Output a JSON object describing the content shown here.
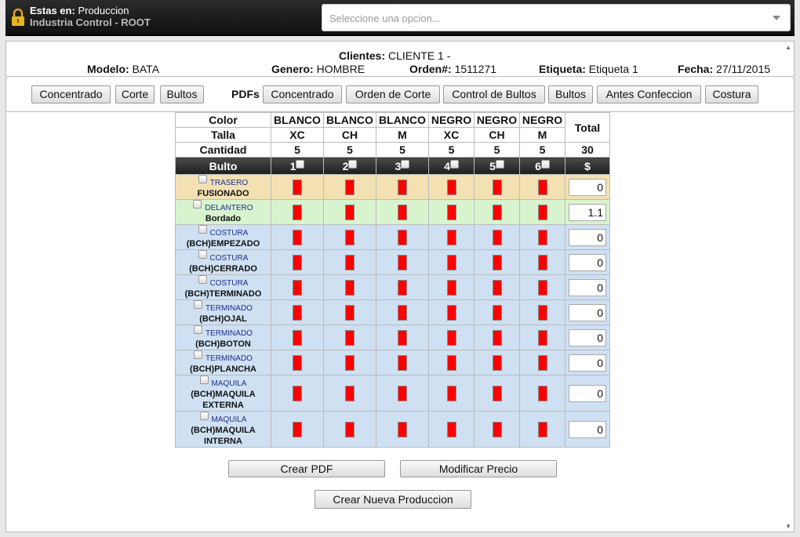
{
  "header": {
    "location_label": "Estas en:",
    "location_value": "Produccion",
    "subtitle": "Industria Control - ROOT",
    "select_placeholder": "Seleccione una opcion..."
  },
  "info": {
    "clientes_label": "Clientes:",
    "clientes_value": "CLIENTE 1 -",
    "modelo_label": "Modelo:",
    "modelo_value": "BATA",
    "genero_label": "Genero:",
    "genero_value": "HOMBRE",
    "orden_label": "Orden#:",
    "orden_value": "1511271",
    "etiqueta_label": "Etiqueta:",
    "etiqueta_value": "Etiqueta 1",
    "fecha_label": "Fecha:",
    "fecha_value": "27/11/2015"
  },
  "toolbar": {
    "concentrado": "Concentrado",
    "corte": "Corte",
    "bultos": "Bultos",
    "pdfs_label": "PDFs",
    "pdf_concentrado": "Concentrado",
    "pdf_orden_corte": "Orden de Corte",
    "pdf_control_bultos": "Control de Bultos",
    "pdf_bultos": "Bultos",
    "pdf_antes_confeccion": "Antes Confeccion",
    "pdf_costura": "Costura"
  },
  "table": {
    "color_label": "Color",
    "talla_label": "Talla",
    "cantidad_label": "Cantidad",
    "bulto_label": "Bulto",
    "total_label": "Total",
    "total_value": "30",
    "currency_label": "$",
    "columns": [
      {
        "color": "BLANCO",
        "talla": "XC",
        "cantidad": "5",
        "bulto": "1"
      },
      {
        "color": "BLANCO",
        "talla": "CH",
        "cantidad": "5",
        "bulto": "2"
      },
      {
        "color": "BLANCO",
        "talla": "M",
        "cantidad": "5",
        "bulto": "3"
      },
      {
        "color": "NEGRO",
        "talla": "XC",
        "cantidad": "5",
        "bulto": "4"
      },
      {
        "color": "NEGRO",
        "talla": "CH",
        "cantidad": "5",
        "bulto": "5"
      },
      {
        "color": "NEGRO",
        "talla": "M",
        "cantidad": "5",
        "bulto": "6"
      }
    ],
    "rows": [
      {
        "stage": "TRASERO",
        "name": "FUSIONADO",
        "price": "0",
        "tone": "tan"
      },
      {
        "stage": "DELANTERO",
        "name": "Bordado",
        "price": "1.1",
        "tone": "green"
      },
      {
        "stage": "COSTURA",
        "name": "(BCH)EMPEZADO",
        "price": "0",
        "tone": "blue"
      },
      {
        "stage": "COSTURA",
        "name": "(BCH)CERRADO",
        "price": "0",
        "tone": "blue"
      },
      {
        "stage": "COSTURA",
        "name": "(BCH)TERMINADO",
        "price": "0",
        "tone": "blue"
      },
      {
        "stage": "TERMINADO",
        "name": "(BCH)OJAL",
        "price": "0",
        "tone": "blue"
      },
      {
        "stage": "TERMINADO",
        "name": "(BCH)BOTON",
        "price": "0",
        "tone": "blue"
      },
      {
        "stage": "TERMINADO",
        "name": "(BCH)PLANCHA",
        "price": "0",
        "tone": "blue"
      },
      {
        "stage": "MAQUILA",
        "name": "(BCH)MAQUILA EXTERNA",
        "price": "0",
        "tone": "blue"
      },
      {
        "stage": "MAQUILA",
        "name": "(BCH)MAQUILA INTERNA",
        "price": "0",
        "tone": "blue"
      }
    ]
  },
  "actions": {
    "crear_pdf": "Crear PDF",
    "modificar_precio": "Modificar Precio",
    "crear_nueva": "Crear Nueva Produccion"
  },
  "colors": {
    "status_red": "#ff0000",
    "row_tan": "#f3e1b3",
    "row_green": "#d8f4cf",
    "row_blue": "#cfe0f3",
    "stage_text": "#1a2f8f"
  }
}
